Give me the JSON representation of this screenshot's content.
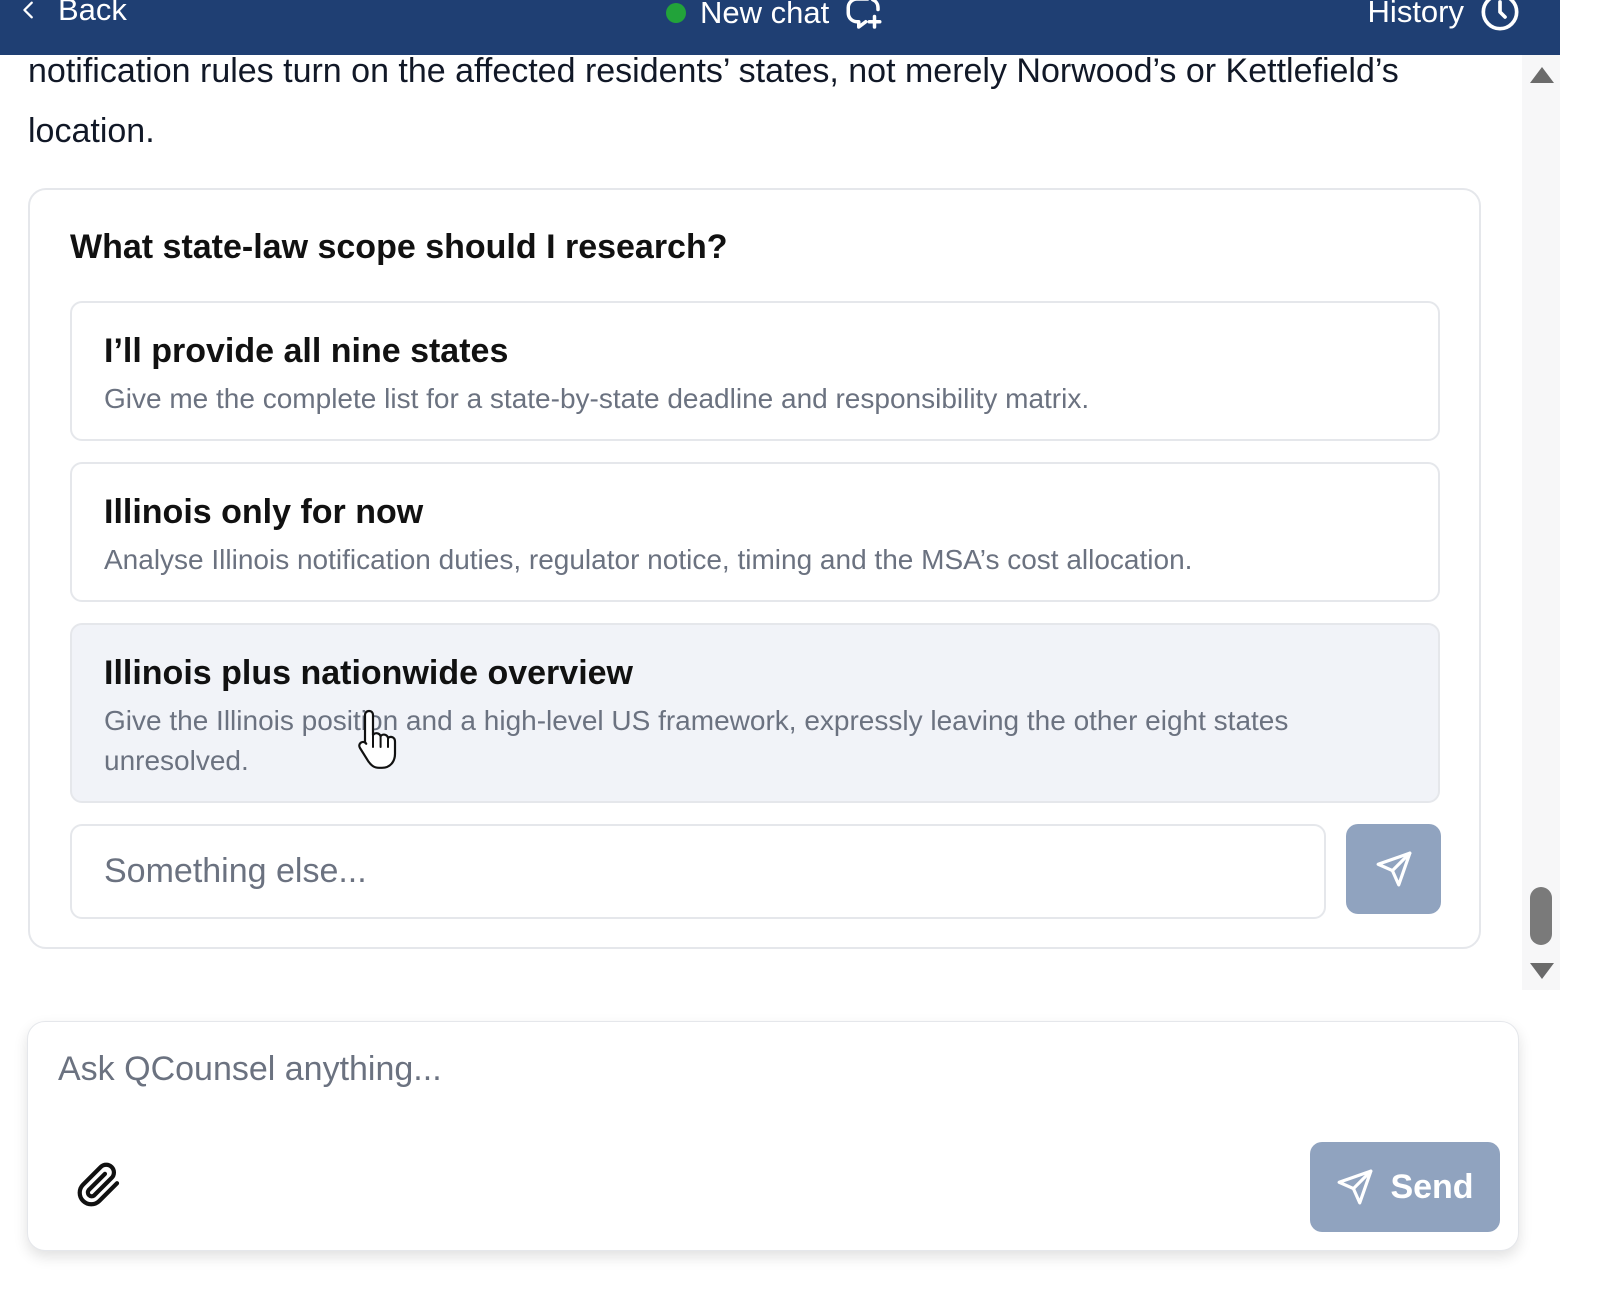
{
  "header": {
    "back_label": "Back",
    "new_chat_label": "New chat",
    "history_label": "History",
    "status_color": "#22a33a"
  },
  "conversation": {
    "intro_text": "notification rules turn on the affected residents’ states, not merely Norwood’s or Kettlefield’s location."
  },
  "question": {
    "title": "What state-law scope should I research?",
    "options": [
      {
        "title": "I’ll provide all nine states",
        "description": "Give me the complete list for a state-by-state deadline and responsibility matrix."
      },
      {
        "title": "Illinois only for now",
        "description": "Analyse Illinois notification duties, regulator notice, timing and the MSA’s cost allocation."
      },
      {
        "title": "Illinois plus nationwide overview",
        "description": "Give the Illinois position and a high-level US framework, expressly leaving the other eight states unresolved."
      }
    ],
    "other_placeholder": "Something else..."
  },
  "composer": {
    "placeholder": "Ask QCounsel anything...",
    "send_label": "Send"
  },
  "colors": {
    "header_bg": "#1f3f73",
    "button_bg": "#90a3bf"
  }
}
